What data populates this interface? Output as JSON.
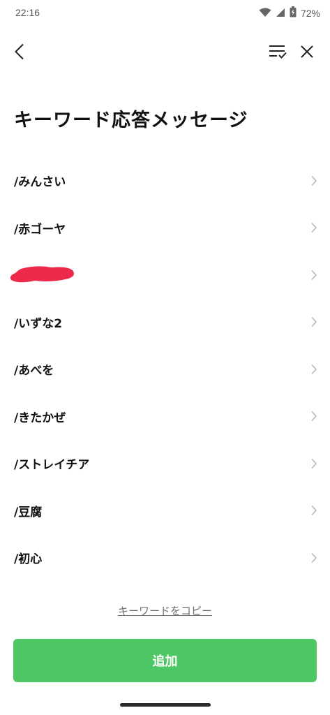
{
  "status_bar": {
    "time": "22:16",
    "battery": "72%"
  },
  "header": {
    "back_icon": "chevron-left-icon",
    "sort_icon": "sort-check-icon",
    "close_icon": "close-icon"
  },
  "page": {
    "title": "キーワード応答メッセージ"
  },
  "keywords": [
    {
      "label": "/みんさい"
    },
    {
      "label": "/赤ゴーヤ"
    },
    {
      "label": ""
    },
    {
      "label": "/いずな2"
    },
    {
      "label": "/あべを"
    },
    {
      "label": "/きたかぜ"
    },
    {
      "label": "/ストレイチア"
    },
    {
      "label": "/豆腐"
    },
    {
      "label": "/初心"
    }
  ],
  "actions": {
    "copy_keywords": "キーワードをコピー",
    "add": "追加"
  },
  "colors": {
    "accent": "#4cc764",
    "redaction": "#ee2a4c",
    "chevron": "#b8b8b8"
  }
}
